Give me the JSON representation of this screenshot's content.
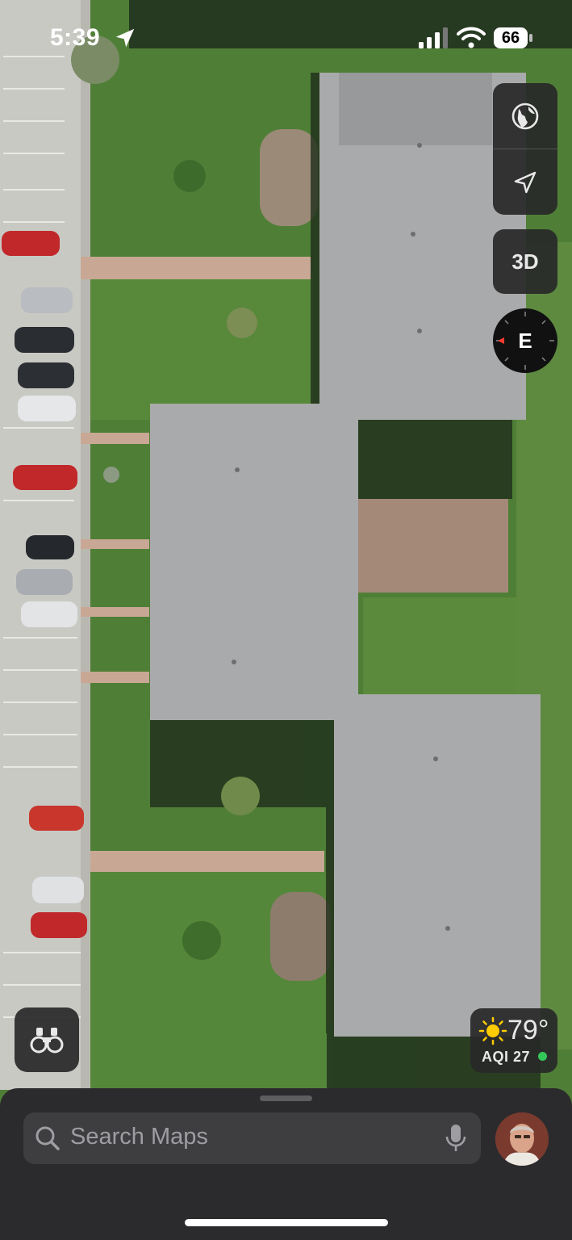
{
  "status_bar": {
    "time": "5:39",
    "battery_level": "66"
  },
  "map_controls": {
    "map_mode_icon": "globe-icon",
    "location_icon": "location-arrow-icon",
    "view_3d_label": "3D",
    "compass_heading": "E"
  },
  "weather": {
    "temperature": "79°",
    "aqi": "AQI 27",
    "aqi_status_color": "#34c759"
  },
  "search": {
    "placeholder": "Search Maps"
  },
  "colors": {
    "roof": "#a9aaab",
    "grass": "#4f7f36",
    "parking_lot": "#c9c9c4",
    "walkway": "#c8a894",
    "car_red": "#c0282a"
  }
}
